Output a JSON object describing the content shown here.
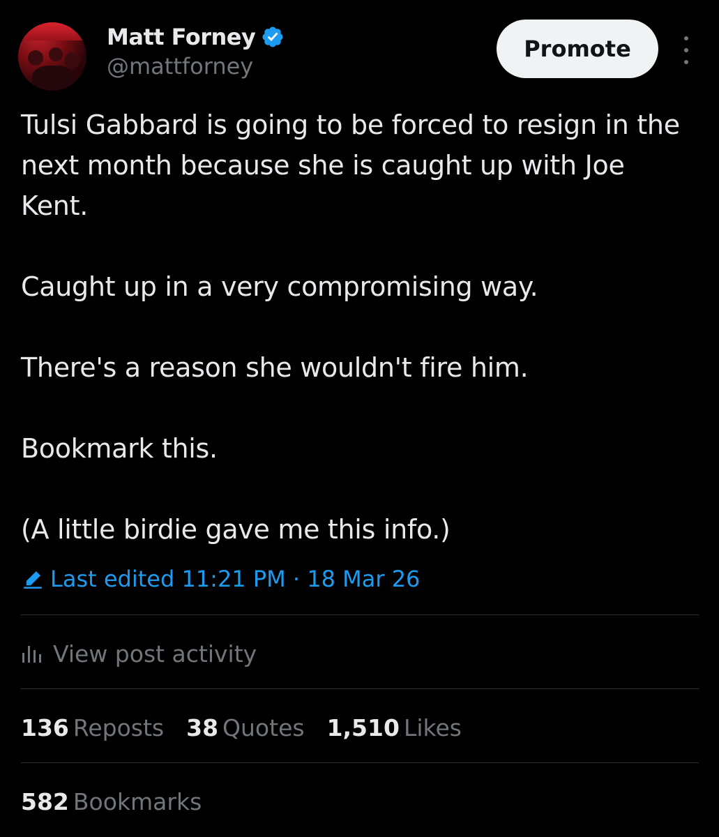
{
  "author": {
    "display_name": "Matt Forney",
    "handle": "@mattforney",
    "verified_icon": "verified-badge-icon",
    "avatar": "profile-photo"
  },
  "header": {
    "promote_label": "Promote",
    "more_icon": "more-options-icon"
  },
  "post": {
    "paragraphs": [
      "Tulsi Gabbard is going to be forced to resign in the next month because she is caught up with Joe Kent.",
      "Caught up in a very compromising way.",
      "There's a reason she wouldn't fire him.",
      "Bookmark this.",
      "(A little birdie gave me this info.)"
    ],
    "edited_label": "Last edited 11:21 PM · 18 Mar 26",
    "edited_icon": "pencil-icon"
  },
  "activity": {
    "label": "View post activity",
    "icon": "bar-chart-icon"
  },
  "stats": {
    "reposts_count": "136",
    "reposts_label": "Reposts",
    "quotes_count": "38",
    "quotes_label": "Quotes",
    "likes_count": "1,510",
    "likes_label": "Likes",
    "bookmarks_count": "582",
    "bookmarks_label": "Bookmarks"
  },
  "colors": {
    "background": "#000000",
    "text_primary": "#e7e9ea",
    "text_secondary": "#71767b",
    "accent_blue": "#1d9bf0",
    "divider": "#2f3336",
    "button_bg": "#eff3f4"
  }
}
